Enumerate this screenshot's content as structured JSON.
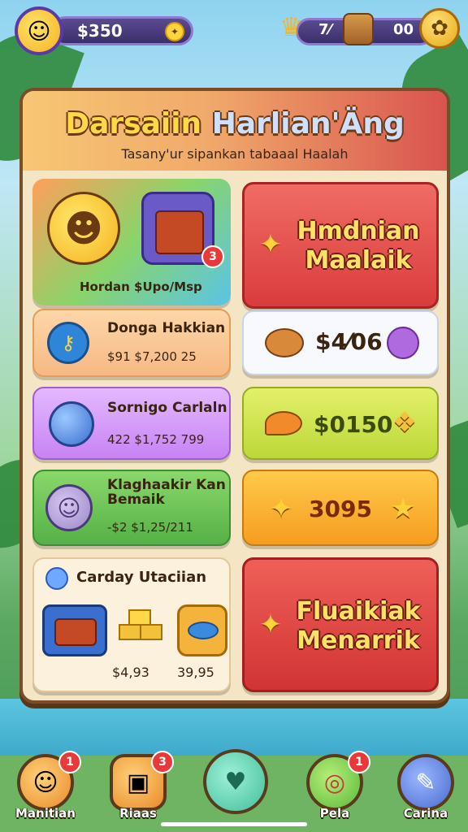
{
  "hud": {
    "coins": "$350",
    "stat1": "7⁄",
    "stat2": "00"
  },
  "panel": {
    "title_part1": "Darsaiin ",
    "title_part2": "Harlian'Äng",
    "subtitle": "Tasany'ur sipankan tabaaal Haalah"
  },
  "cards": {
    "l1_label": "Hordan $Upo/Msp",
    "l1_badge": "3",
    "l2_title": "Donga Hakkian",
    "l2_sub": "$91 $7,200 25",
    "l3_title": "Sornigo Carlaln",
    "l3_sub": "422 $1,752 799",
    "l4_title": "Klaghaakir Kan Bemaik",
    "l4_sub": "-$2 $1,25/211",
    "l5_title": "Carday Utaciian",
    "l5_price1": "$4,93",
    "l5_price2": "39,95",
    "r1_line1": "Hmdnian",
    "r1_line2": "Maalaik",
    "r2_price": "$4⁄06",
    "r3_price": "$0150",
    "r4_price": "3095",
    "r5_line1": "Fluaikiak",
    "r5_line2": "Menarrik"
  },
  "nav": [
    {
      "label": "Manitian",
      "badge": "1"
    },
    {
      "label": "Riaas",
      "badge": "3"
    },
    {
      "label": "",
      "badge": ""
    },
    {
      "label": "Pela",
      "badge": "1"
    },
    {
      "label": "Carina",
      "badge": ""
    }
  ],
  "colors": {
    "accent_gold": "#ffd84a",
    "panel_bg": "#f4e5c4",
    "red_card": "#d93c3c"
  }
}
